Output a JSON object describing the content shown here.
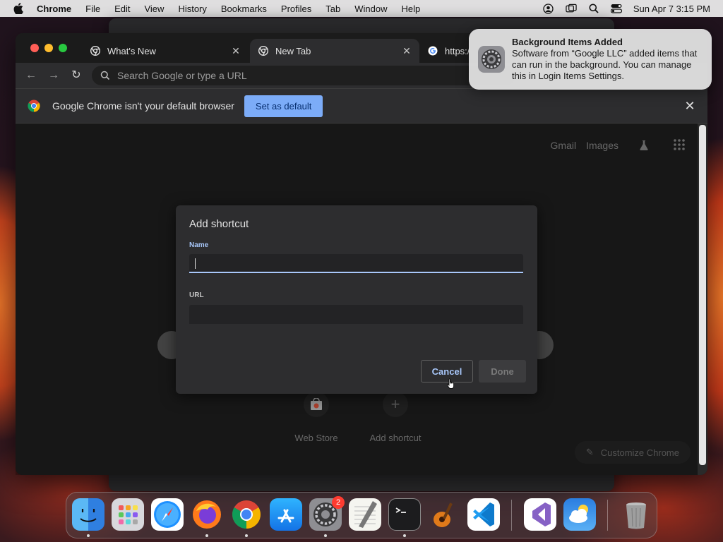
{
  "menubar": {
    "app": "Chrome",
    "items": [
      "File",
      "Edit",
      "View",
      "History",
      "Bookmarks",
      "Profiles",
      "Tab",
      "Window",
      "Help"
    ],
    "clock": "Sun Apr 7  3:15 PM"
  },
  "chrome": {
    "tabs": [
      {
        "label": "What's New",
        "icon": "chrome-icon"
      },
      {
        "label": "New Tab",
        "icon": "chrome-icon"
      },
      {
        "label": "https:/",
        "icon": "google-icon"
      }
    ],
    "omnibox_placeholder": "Search Google or type a URL",
    "infobar": {
      "message": "Google Chrome isn't your default browser",
      "button": "Set as default"
    },
    "top_links": [
      "Gmail",
      "Images"
    ],
    "shortcuts": [
      {
        "label": "Web Store"
      },
      {
        "label": "Add shortcut"
      }
    ],
    "customize": "Customize Chrome"
  },
  "dialog": {
    "title": "Add shortcut",
    "name_label": "Name",
    "name_value": "",
    "url_label": "URL",
    "url_value": "",
    "cancel": "Cancel",
    "done": "Done"
  },
  "notification": {
    "title": "Background Items Added",
    "body": "Software from “Google LLC” added items that can run in the background. You can manage this in Login Items Settings."
  },
  "dock": {
    "apps": [
      "Finder",
      "Launchpad",
      "Safari",
      "Firefox",
      "Chrome",
      "App Store",
      "System Settings",
      "TextEdit",
      "Terminal",
      "GarageBand",
      "VS Code",
      "Visual Studio",
      "Weather",
      "Trash"
    ],
    "settings_badge": "2"
  },
  "colors": {
    "accent": "#a8c7fa",
    "default_button": "#7cacf8"
  }
}
